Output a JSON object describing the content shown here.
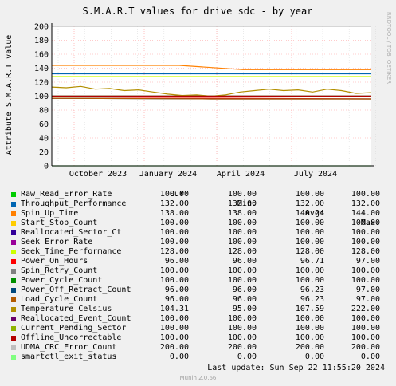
{
  "chart_data": {
    "type": "line",
    "title": "S.M.A.R.T values for drive sdc - by year",
    "ylabel": "Attribute S.M.A.R.T value",
    "side_label": "RRDTOOL / TOBI OETIKER",
    "ylim": [
      0,
      200
    ],
    "yticks": [
      0,
      20,
      40,
      60,
      80,
      100,
      120,
      140,
      160,
      180,
      200
    ],
    "xticks": [
      "October 2023",
      "January 2024",
      "April 2024",
      "July 2024"
    ],
    "series": [
      {
        "name": "Raw_Read_Error_Rate",
        "color": "#00cc00",
        "values": [
          100,
          100,
          100
        ]
      },
      {
        "name": "Throughput_Performance",
        "color": "#0066b3",
        "values": [
          132,
          132,
          132
        ]
      },
      {
        "name": "Spin_Up_Time",
        "color": "#ff8000",
        "values": [
          144,
          144,
          144,
          138,
          138,
          138
        ]
      },
      {
        "name": "Start_Stop_Count",
        "color": "#ffcc00",
        "values": [
          100,
          100
        ]
      },
      {
        "name": "Reallocated_Sector_Ct",
        "color": "#330099",
        "values": [
          100,
          100
        ]
      },
      {
        "name": "Seek_Error_Rate",
        "color": "#990099",
        "values": [
          100,
          100
        ]
      },
      {
        "name": "Seek_Time_Performance",
        "color": "#ccff00",
        "values": [
          128,
          128
        ]
      },
      {
        "name": "Power_On_Hours",
        "color": "#ff0000",
        "values": [
          97,
          97,
          96
        ]
      },
      {
        "name": "Spin_Retry_Count",
        "color": "#808080",
        "values": [
          100,
          100
        ]
      },
      {
        "name": "Power_Cycle_Count",
        "color": "#008f00",
        "values": [
          100,
          100
        ]
      },
      {
        "name": "Power_Off_Retract_Count",
        "color": "#00487d",
        "values": [
          97,
          96,
          96
        ]
      },
      {
        "name": "Load_Cycle_Count",
        "color": "#b35a00",
        "values": [
          97,
          96,
          96
        ]
      },
      {
        "name": "Temperature_Celsius",
        "color": "#b38f00",
        "values": [
          113,
          112,
          114,
          110,
          111,
          108,
          109,
          106,
          103,
          101,
          102,
          100,
          102,
          106,
          108,
          110,
          108,
          109,
          106,
          110,
          108,
          104,
          105
        ]
      },
      {
        "name": "Reallocated_Event_Count",
        "color": "#6b006b",
        "values": [
          100,
          100
        ]
      },
      {
        "name": "Current_Pending_Sector",
        "color": "#8fb300",
        "values": [
          100,
          100
        ]
      },
      {
        "name": "Offline_Uncorrectable",
        "color": "#b30000",
        "values": [
          100,
          100
        ]
      },
      {
        "name": "UDMA_CRC_Error_Count",
        "color": "#bebebe",
        "values": [
          200,
          200
        ]
      },
      {
        "name": "smartctl_exit_status",
        "color": "#80ff80",
        "values": [
          0,
          0
        ]
      }
    ]
  },
  "legend": {
    "headers": [
      "Cur:",
      "Min:",
      "Avg:",
      "Max:"
    ],
    "rows": [
      {
        "name": "Raw_Read_Error_Rate",
        "color": "#00cc00",
        "cur": "100.00",
        "min": "100.00",
        "avg": "100.00",
        "max": "100.00"
      },
      {
        "name": "Throughput_Performance",
        "color": "#0066b3",
        "cur": "132.00",
        "min": "132.00",
        "avg": "132.00",
        "max": "132.00"
      },
      {
        "name": "Spin_Up_Time",
        "color": "#ff8000",
        "cur": "138.00",
        "min": "138.00",
        "avg": "140.24",
        "max": "144.00"
      },
      {
        "name": "Start_Stop_Count",
        "color": "#ffcc00",
        "cur": "100.00",
        "min": "100.00",
        "avg": "100.00",
        "max": "100.00"
      },
      {
        "name": "Reallocated_Sector_Ct",
        "color": "#330099",
        "cur": "100.00",
        "min": "100.00",
        "avg": "100.00",
        "max": "100.00"
      },
      {
        "name": "Seek_Error_Rate",
        "color": "#990099",
        "cur": "100.00",
        "min": "100.00",
        "avg": "100.00",
        "max": "100.00"
      },
      {
        "name": "Seek_Time_Performance",
        "color": "#ccff00",
        "cur": "128.00",
        "min": "128.00",
        "avg": "128.00",
        "max": "128.00"
      },
      {
        "name": "Power_On_Hours",
        "color": "#ff0000",
        "cur": "96.00",
        "min": "96.00",
        "avg": "96.71",
        "max": "97.00"
      },
      {
        "name": "Spin_Retry_Count",
        "color": "#808080",
        "cur": "100.00",
        "min": "100.00",
        "avg": "100.00",
        "max": "100.00"
      },
      {
        "name": "Power_Cycle_Count",
        "color": "#008f00",
        "cur": "100.00",
        "min": "100.00",
        "avg": "100.00",
        "max": "100.00"
      },
      {
        "name": "Power_Off_Retract_Count",
        "color": "#00487d",
        "cur": "96.00",
        "min": "96.00",
        "avg": "96.23",
        "max": "97.00"
      },
      {
        "name": "Load_Cycle_Count",
        "color": "#b35a00",
        "cur": "96.00",
        "min": "96.00",
        "avg": "96.23",
        "max": "97.00"
      },
      {
        "name": "Temperature_Celsius",
        "color": "#b38f00",
        "cur": "104.31",
        "min": "95.00",
        "avg": "107.59",
        "max": "222.00"
      },
      {
        "name": "Reallocated_Event_Count",
        "color": "#6b006b",
        "cur": "100.00",
        "min": "100.00",
        "avg": "100.00",
        "max": "100.00"
      },
      {
        "name": "Current_Pending_Sector",
        "color": "#8fb300",
        "cur": "100.00",
        "min": "100.00",
        "avg": "100.00",
        "max": "100.00"
      },
      {
        "name": "Offline_Uncorrectable",
        "color": "#b30000",
        "cur": "100.00",
        "min": "100.00",
        "avg": "100.00",
        "max": "100.00"
      },
      {
        "name": "UDMA_CRC_Error_Count",
        "color": "#bebebe",
        "cur": "200.00",
        "min": "200.00",
        "avg": "200.00",
        "max": "200.00"
      },
      {
        "name": "smartctl_exit_status",
        "color": "#80ff80",
        "cur": "0.00",
        "min": "0.00",
        "avg": "0.00",
        "max": "0.00"
      }
    ]
  },
  "footer": {
    "last_update": "Last update: Sun Sep 22 11:55:20 2024",
    "munin": "Munin 2.0.66"
  }
}
